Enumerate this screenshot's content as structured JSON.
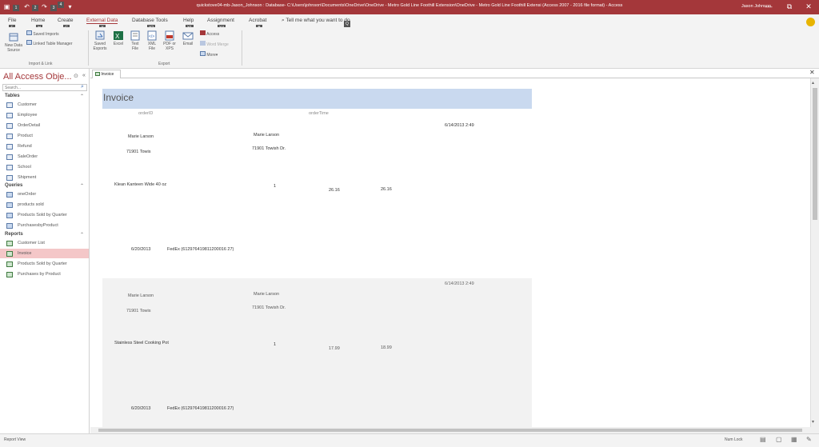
{
  "titlebar": {
    "title": "quickstove04-mb-Jason_Johnson : Database- C:\\Users\\johnson\\Documents\\OneDrive\\OneDrive - Metro Gold Line Foothill Extension\\OneDrive - Metro Gold Line Foothill Extensi (Access 2007 - 2016 file format) - Access",
    "user": "Jason Johnson",
    "keytips": [
      "1",
      "2",
      "3",
      "4"
    ],
    "minimize": "—",
    "restore": "⧉",
    "close": "✕"
  },
  "ribbon_tabs": [
    {
      "label": "File",
      "keytip": "F"
    },
    {
      "label": "Home",
      "keytip": "H"
    },
    {
      "label": "Create",
      "keytip": "C"
    },
    {
      "label": "External Data",
      "keytip": "X"
    },
    {
      "label": "Database Tools",
      "keytip": "Y2"
    },
    {
      "label": "Help",
      "keytip": "Y1"
    },
    {
      "label": "Assignment",
      "keytip": "Y4"
    },
    {
      "label": "Acrobat",
      "keytip": "B"
    }
  ],
  "tell_me": {
    "placeholder": "Tell me what you want to do",
    "keytip": "Q"
  },
  "ribbon": {
    "new_data_source": "New Data Source",
    "saved_imports": "Saved Imports",
    "linked_table_manager": "Linked Table Manager",
    "import_group": "Import & Link",
    "saved_exports": "Saved Exports",
    "excel": "Excel",
    "text_file": "Text File",
    "xml_file": "XML File",
    "pdf_xps": "PDF or XPS",
    "email": "Email",
    "access": "Access",
    "word_merge": "Word Merge",
    "more": "More",
    "export_group": "Export"
  },
  "nav": {
    "title": "All Access Obje...",
    "search_placeholder": "Search...",
    "sections": {
      "tables": "Tables",
      "queries": "Queries",
      "reports": "Reports"
    },
    "tables": [
      "Customer",
      "Employee",
      "OrderDetail",
      "Product",
      "Refund",
      "SaleOrder",
      "School",
      "Shipment"
    ],
    "queries": [
      "oneOrder",
      "products sold",
      "Products Sold by Quarter",
      "PurchasesbyProduct"
    ],
    "reports": [
      "Customer List",
      "Invoice",
      "Products Sold by Quarter",
      "Purchases by Product"
    ]
  },
  "doc_tab": {
    "label": "Invoice"
  },
  "report": {
    "title": "Invoice",
    "col_order_id": "orderID",
    "col_order_time": "orderTime",
    "records": [
      {
        "datetime": "6/14/2013 2:49",
        "customer": "Marie Larson",
        "address": "71901 Towis",
        "ship_name": "Marie Larson",
        "ship_address": "71901 Towish Dr.",
        "product": "Klean Kanteen Wide 40 oz",
        "qty": "1",
        "price": "26.16",
        "total": "26.16",
        "ship_date": "6/20/2013",
        "shipper": "FedEx (612976419811200016 27)"
      },
      {
        "datetime": "6/14/2013 2:49",
        "customer": "Marie Larson",
        "address": "71901 Towis",
        "ship_name": "Marie Larson",
        "ship_address": "71901 Towish Dr.",
        "product": "Stainless Steel Cooking Pot",
        "qty": "1",
        "price": "17.99",
        "total": "18.99",
        "ship_date": "6/20/2013",
        "shipper": "FedEx (612976419811200016 27)"
      }
    ]
  },
  "status": {
    "left": "Report View",
    "num_lock": "Num Lock"
  },
  "colors": {
    "accent": "#a4373a",
    "header_band": "#c9d9ef",
    "alt_band": "#f2f2f2"
  }
}
